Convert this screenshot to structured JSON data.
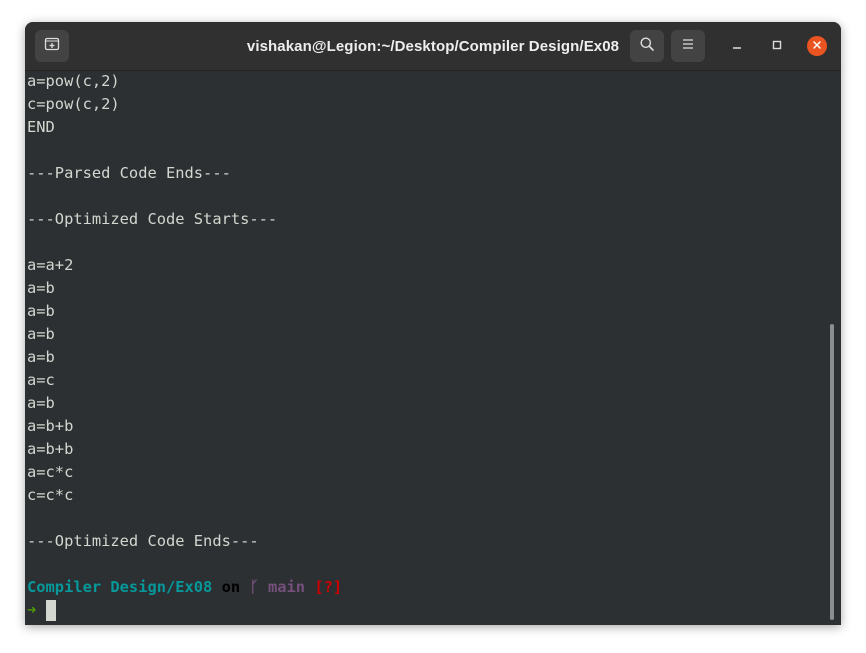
{
  "window": {
    "title": "vishakan@Legion:~/Desktop/Compiler Design/Ex08"
  },
  "icons": {
    "new_tab": "new-tab-icon",
    "search": "search-icon",
    "menu": "hamburger-menu-icon",
    "minimize": "minimize-icon",
    "maximize": "maximize-icon",
    "close": "close-icon",
    "git_branch": "git-branch-icon"
  },
  "terminal": {
    "lines": [
      "a=pow(c,2)",
      "c=pow(c,2)",
      "END",
      "",
      "---Parsed Code Ends---",
      "",
      "---Optimized Code Starts---",
      "",
      "a=a+2",
      "a=b",
      "a=b",
      "a=b",
      "a=b",
      "a=c",
      "a=b",
      "a=b+b",
      "a=b+b",
      "a=c*c",
      "c=c*c",
      "",
      "---Optimized Code Ends---",
      ""
    ],
    "prompt": {
      "directory": "Compiler Design/Ex08",
      "on": "on",
      "branch_glyph": "ᚴ",
      "branch": "main",
      "status": "[?]",
      "arrow": "➜"
    }
  },
  "colors": {
    "background": "#2c3033",
    "titlebar": "#303030",
    "text": "#d3d7cf",
    "directory": "#06989a",
    "branch": "#75507b",
    "status": "#cc0000",
    "arrow": "#4e9a06",
    "close_button": "#e95420"
  }
}
